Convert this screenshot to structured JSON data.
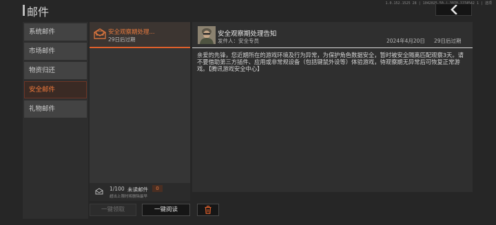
{
  "header": {
    "title": "邮件",
    "sys_info": "1.0.152.1525 28 | 1042025 50 | 3070 1274542 1 | 选项",
    "back_icon": "chevron-left-icon"
  },
  "categories": [
    {
      "label": "系统邮件",
      "active": false
    },
    {
      "label": "市场邮件",
      "active": false
    },
    {
      "label": "物资归还",
      "active": false
    },
    {
      "label": "安全邮件",
      "active": true
    },
    {
      "label": "礼物邮件",
      "active": false
    }
  ],
  "mail_list": {
    "items": [
      {
        "title": "安全观察期处理...",
        "expire": "29日后过期",
        "icon": "envelope-icon"
      }
    ],
    "footer": {
      "count": "1/100",
      "unread_label": "未读邮件",
      "unread_count": "0",
      "note": "超出上限时将删除最早"
    }
  },
  "actions": {
    "claim_all": "一键领取",
    "read_all": "一键阅读",
    "delete_icon": "trash-icon"
  },
  "detail": {
    "title": "安全观察期处理告知",
    "sender": "发件人：安全专员",
    "date": "2024年4月20日",
    "expire": "29日后过期",
    "body": "亲爱的先锋，您近期所在的游戏环境及行为异常，为保护角色数据安全，暂时被安全隔离匹配观察3天。请不要借助第三方插件、应用或非常规设备（包括键鼠外设等）体验游戏，待观察期无异常后可恢复正常游戏。【腾讯游戏安全中心】"
  },
  "colors": {
    "accent": "#e0602b",
    "accent_text": "#e87a3e",
    "background": "#262626"
  }
}
